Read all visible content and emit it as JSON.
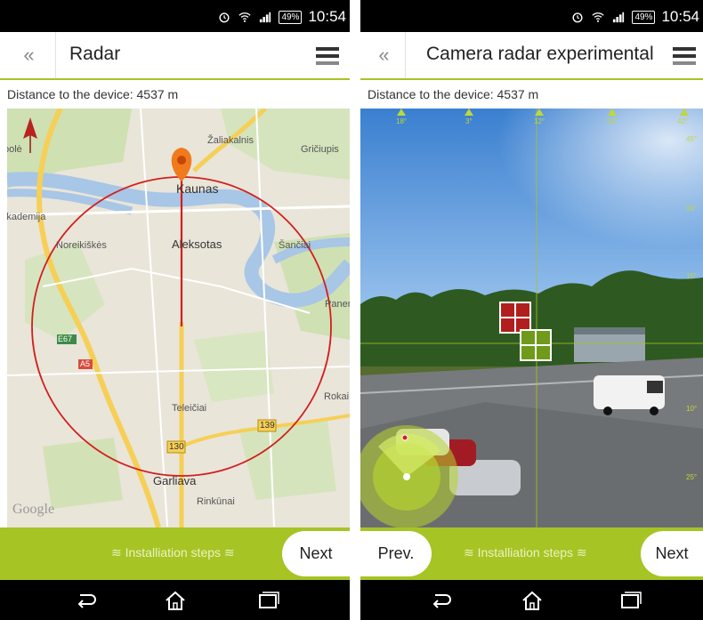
{
  "status": {
    "battery": "49%",
    "time": "10:54"
  },
  "left": {
    "title": "Radar",
    "back_label": "«",
    "distance": "Distance to the device: 4537 m",
    "map_labels": {
      "kaunas": "Kaunas",
      "zaliakalnis": "Žaliakalnis",
      "griciupis": "Gričiupis",
      "pole": "polė",
      "akademija": "Akademija",
      "noreikiskes": "Noreikiškės",
      "aleksotas": "Aleksotas",
      "sanciai": "Šančiai",
      "panemune": "Panemunė",
      "teleiciai": "Teleičiai",
      "rokai": "Rokai",
      "garliava": "Garliava",
      "rinkunai": "Rinkūnai",
      "e67": "E67",
      "a5": "A5",
      "r139": "139",
      "r130": "130",
      "google": "Google"
    },
    "steps": "≋ Installiation steps ≋",
    "next": "Next"
  },
  "right": {
    "title": "Camera radar experimental",
    "back_label": "«",
    "distance": "Distance to the device: 4537 m",
    "scale_top": [
      "18°",
      "3°",
      "12°",
      "33°",
      "42°"
    ],
    "scale_side": [
      "45°",
      "34°",
      "15°",
      "10°",
      "25°"
    ],
    "steps": "≋ Installiation steps ≋",
    "prev": "Prev.",
    "next": "Next"
  },
  "colors": {
    "accent": "#a6c424",
    "radar": "#d21f1f",
    "pin": "#f07a1c",
    "red_target": "#b11e1e",
    "green_target": "#6f9a1a"
  }
}
